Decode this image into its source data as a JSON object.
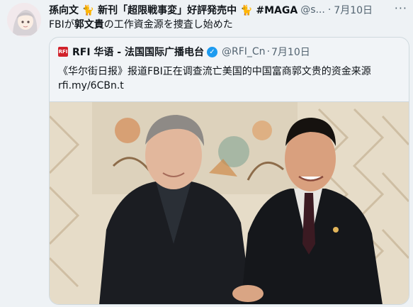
{
  "tweet": {
    "author_name": "孫向文 🐈 新刊「超限戦事変」好評発売中 🐈 #MAGA",
    "handle": "@s...",
    "separator": "·",
    "date": "7月10日",
    "more_label": "···",
    "text_prefix": "FBIが",
    "text_bold": "郭文貴",
    "text_suffix": "の工作資金源を捜査し始めた"
  },
  "quote": {
    "logo_text": "RFI",
    "author_name": "RFI 华语 - 法国国际广播电台",
    "handle": "@RFI_Cn",
    "separator": "·",
    "date": "7月10日",
    "text": "《华尔街日报》报道FBI正在调查流亡美国的中国富商郭文贵的资金来源",
    "link": "rfi.my/6CBn.t"
  },
  "icons": {
    "verified": "verified-badge-icon",
    "more": "more-options-icon"
  },
  "colors": {
    "accent": "#1d9bf0",
    "rfi_red": "#d1222b",
    "muted_text": "#536471"
  }
}
